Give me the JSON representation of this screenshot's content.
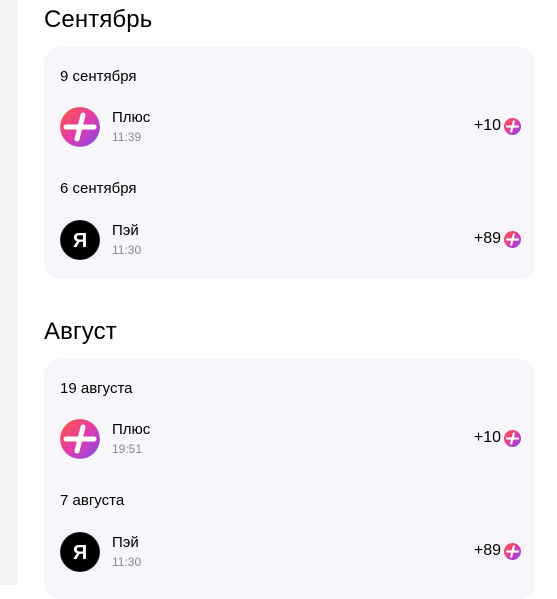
{
  "colors": {
    "plus_gradient_start": "#ff5a36",
    "plus_gradient_mid": "#e63aa8",
    "plus_gradient_end": "#7a4cf0",
    "pay_icon_bg": "#000000",
    "card_bg": "#f7f7fb",
    "time_text": "#8a8a8f"
  },
  "months": [
    {
      "title": "Сентябрь",
      "days": [
        {
          "title": "9 сентября",
          "transactions": [
            {
              "name": "Плюс",
              "time": "11:39",
              "amount": "+10",
              "icon": "plus-logo-icon"
            }
          ]
        },
        {
          "title": "6 сентября",
          "transactions": [
            {
              "name": "Пэй",
              "time": "11:30",
              "amount": "+89",
              "icon": "yandex-logo-icon",
              "icon_letter": "Я"
            }
          ]
        }
      ]
    },
    {
      "title": "Август",
      "days": [
        {
          "title": "19 августа",
          "transactions": [
            {
              "name": "Плюс",
              "time": "19:51",
              "amount": "+10",
              "icon": "plus-logo-icon"
            }
          ]
        },
        {
          "title": "7 августа",
          "transactions": [
            {
              "name": "Пэй",
              "time": "11:30",
              "amount": "+89",
              "icon": "yandex-logo-icon",
              "icon_letter": "Я"
            }
          ]
        }
      ]
    }
  ]
}
